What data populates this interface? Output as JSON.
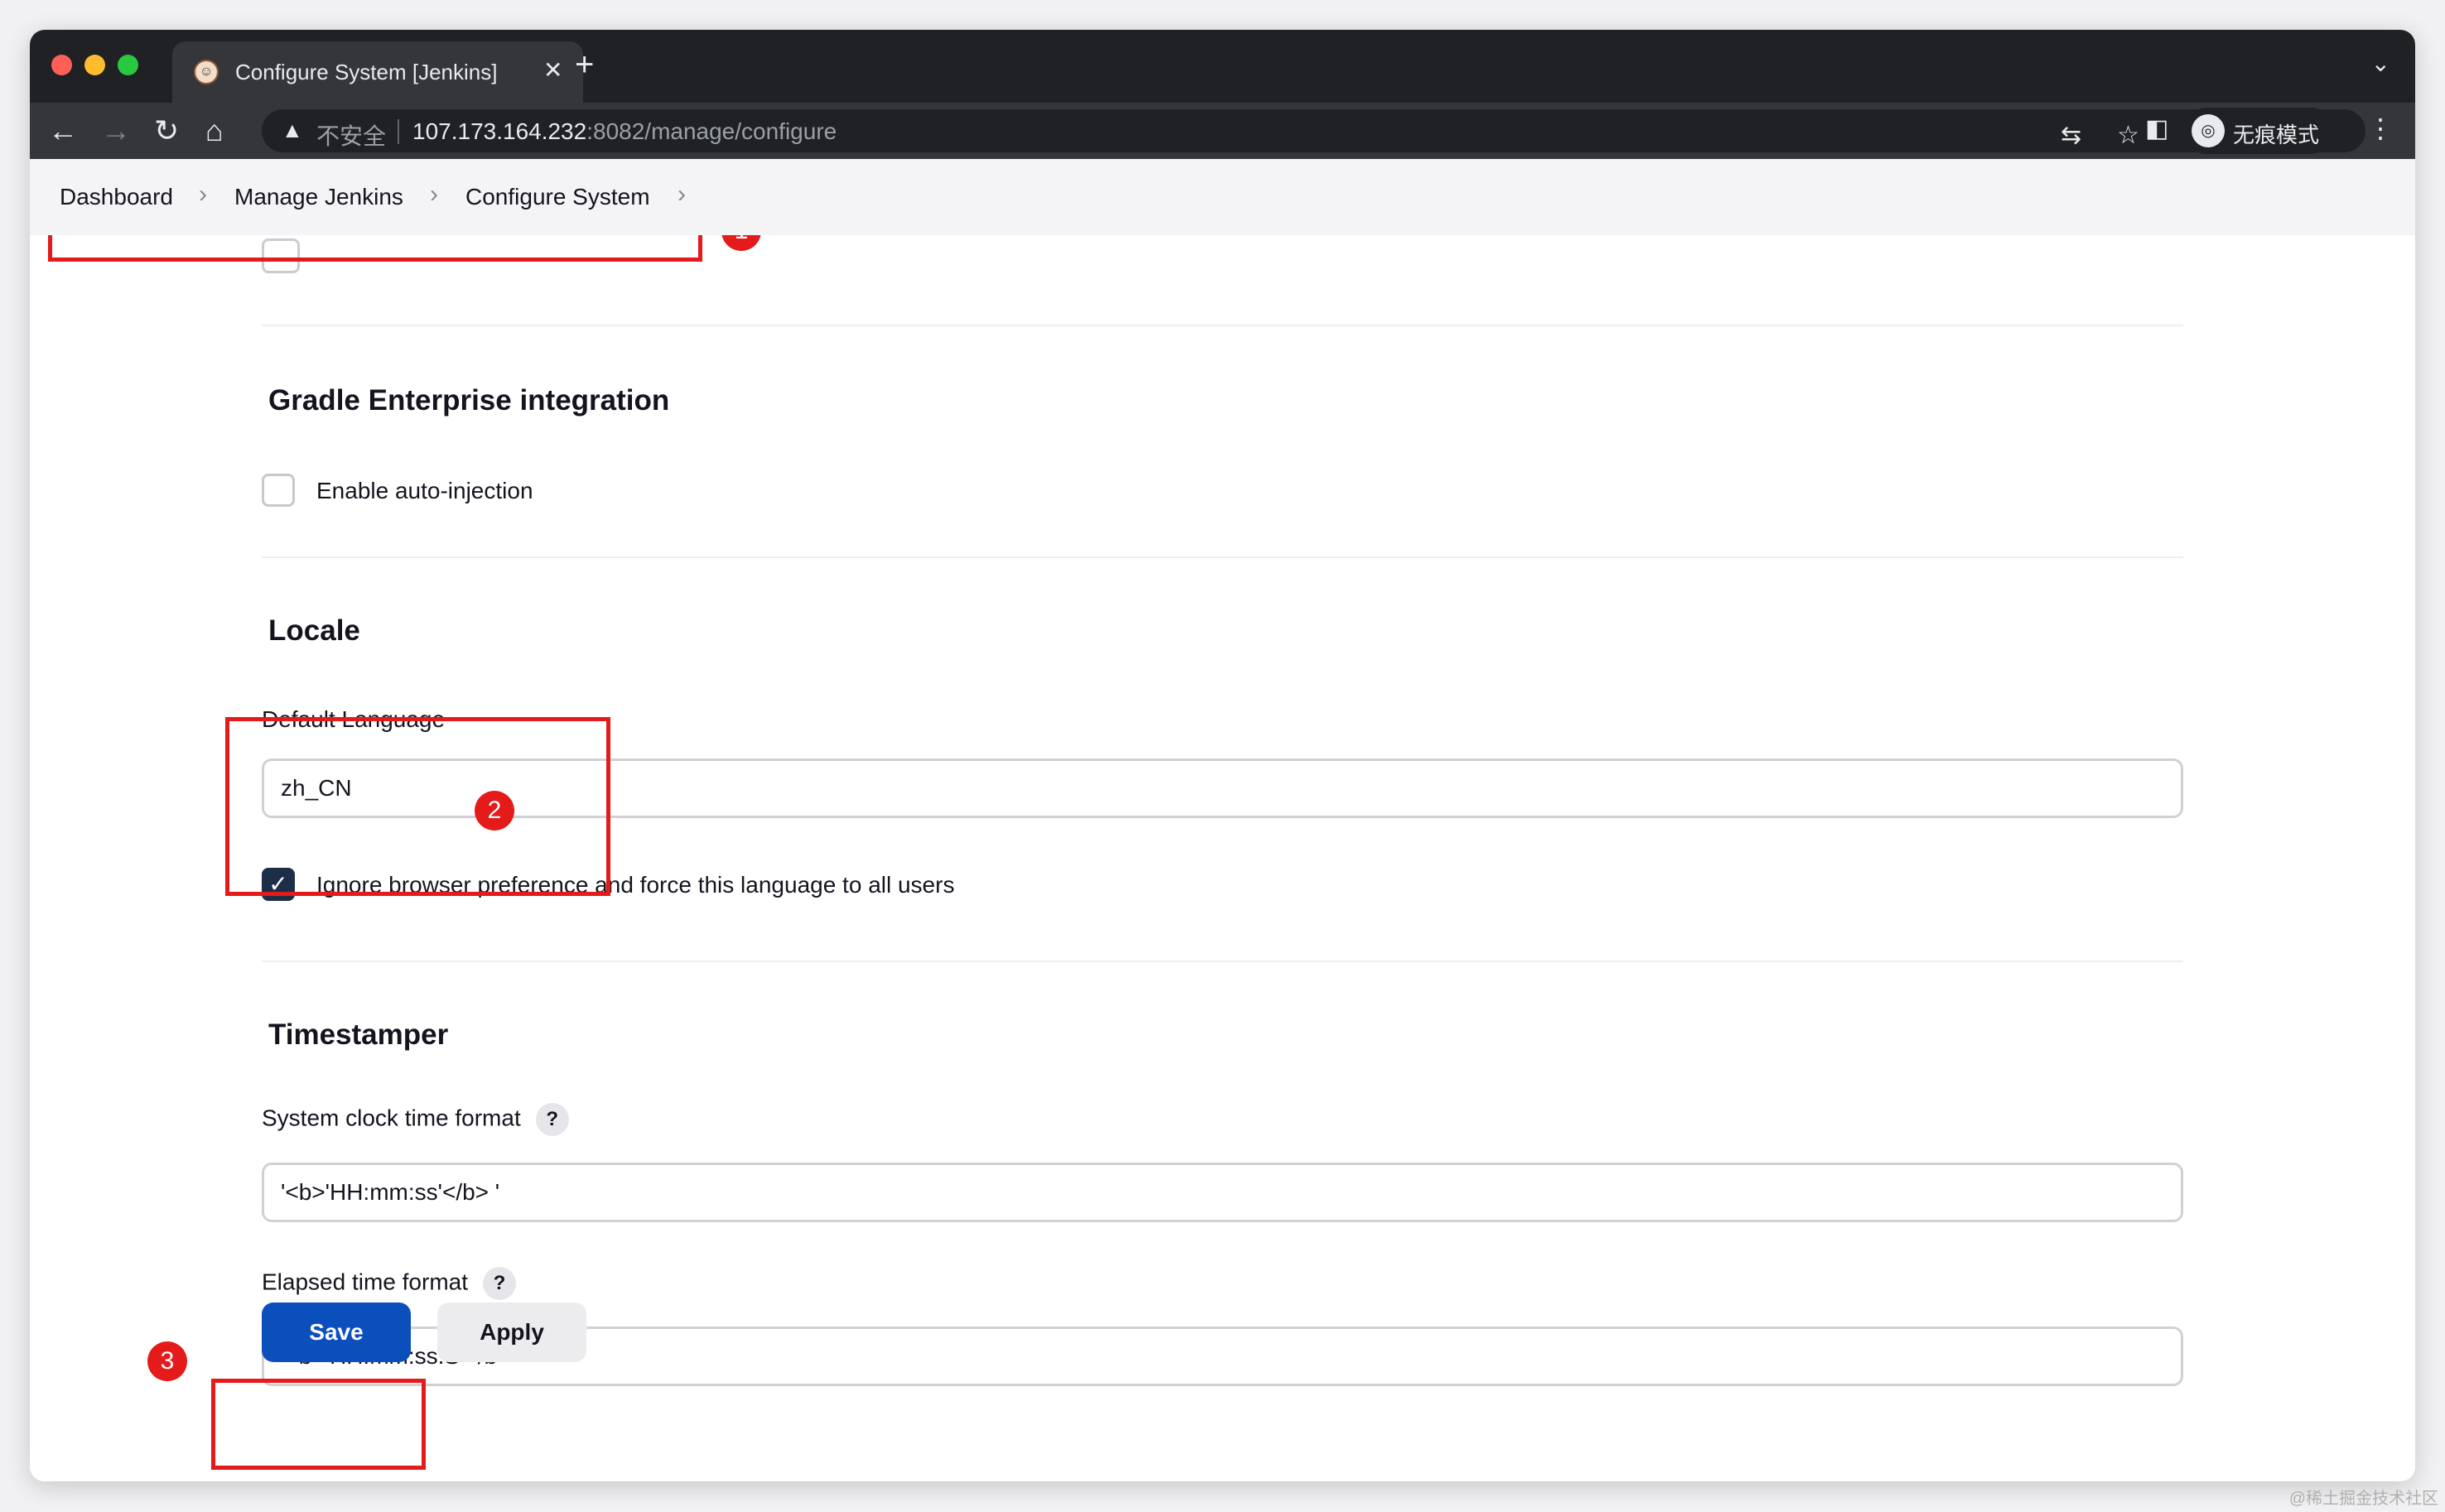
{
  "browser": {
    "tab_title": "Configure System [Jenkins]",
    "new_tab_symbol": "+",
    "close_symbol": "✕",
    "insecure_label": "不安全",
    "url_host": "107.173.164.232",
    "url_rest": ":8082/manage/configure",
    "incognito_label": "无痕模式"
  },
  "breadcrumb": {
    "items": [
      "Dashboard",
      "Manage Jenkins",
      "Configure System"
    ]
  },
  "sections": {
    "gradle": {
      "title": "Gradle Enterprise integration",
      "checkbox_label": "Enable auto-injection",
      "checked": false
    },
    "locale": {
      "title": "Locale",
      "default_language_label": "Default Language",
      "default_language_value": "zh_CN",
      "ignore_label": "Ignore browser preference and force this language to all users",
      "ignore_checked": true
    },
    "timestamper": {
      "title": "Timestamper",
      "system_clock_label": "System clock time format",
      "system_clock_value": "'<b>'HH:mm:ss'</b> '",
      "elapsed_label": "Elapsed time format",
      "elapsed_value": "'<b>'HH:mm:ss.S'</b> '"
    }
  },
  "help_symbol": "?",
  "buttons": {
    "save": "Save",
    "apply": "Apply"
  },
  "annotations": [
    "1",
    "2",
    "3"
  ],
  "watermark": "@稀土掘金技术社区",
  "colors": {
    "annotation_red": "#e51a1a",
    "save_blue": "#0b4fbd",
    "checkbox_navy": "#1d2f48"
  }
}
